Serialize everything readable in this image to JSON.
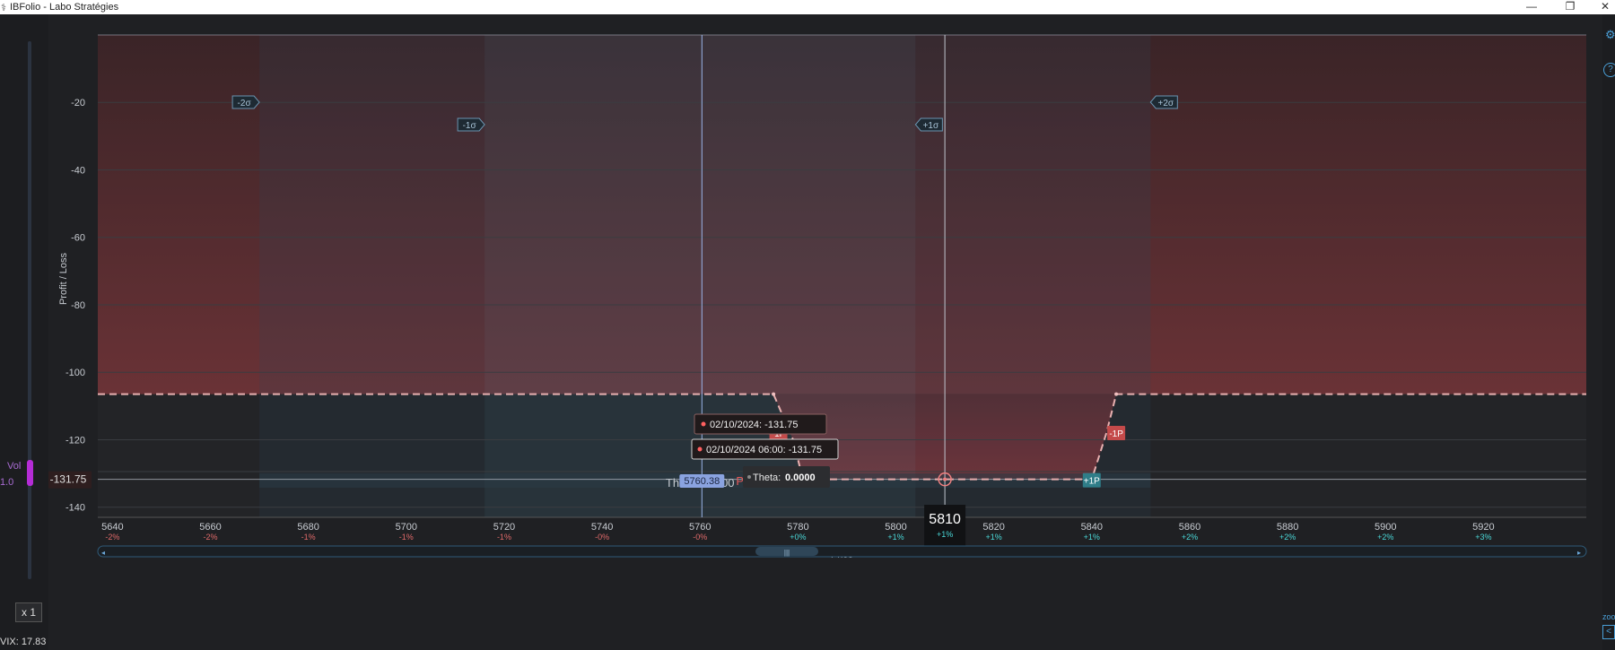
{
  "window": {
    "title": "IBFolio - Labo Stratégies",
    "minimize": "—",
    "restore": "❐",
    "close": "✕"
  },
  "left_panel": {
    "vol_label": "Vol",
    "vol_value": "1.0",
    "x1_button": "x 1",
    "vix": "VIX: 17.83"
  },
  "right_panel": {
    "help": "?",
    "zoom_label": "zoo",
    "zoom_btn": "<"
  },
  "chart_data": {
    "type": "line",
    "xlabel": "Price",
    "ylabel": "Profit / Loss",
    "xlim": [
      5637,
      5941
    ],
    "ylim": [
      -143,
      0
    ],
    "x_ticks": [
      {
        "value": 5640,
        "pct": "-2%"
      },
      {
        "value": 5660,
        "pct": "-2%"
      },
      {
        "value": 5680,
        "pct": "-1%"
      },
      {
        "value": 5700,
        "pct": "-1%"
      },
      {
        "value": 5720,
        "pct": "-1%"
      },
      {
        "value": 5740,
        "pct": "-0%"
      },
      {
        "value": 5760,
        "pct": "-0%"
      },
      {
        "value": 5780,
        "pct": "+0%"
      },
      {
        "value": 5800,
        "pct": "+1%"
      },
      {
        "value": 5810,
        "pct": "+1%"
      },
      {
        "value": 5820,
        "pct": "+1%"
      },
      {
        "value": 5840,
        "pct": "+1%"
      },
      {
        "value": 5860,
        "pct": "+2%"
      },
      {
        "value": 5880,
        "pct": "+2%"
      },
      {
        "value": 5900,
        "pct": "+2%"
      },
      {
        "value": 5920,
        "pct": "+3%"
      }
    ],
    "y_ticks": [
      -20,
      -40,
      -60,
      -80,
      -100,
      -120,
      -140
    ],
    "sigma_bands": [
      {
        "label": "-2σ",
        "x": 5670
      },
      {
        "label": "-1σ",
        "x": 5716
      },
      {
        "label": "+1σ",
        "x": 5804
      },
      {
        "label": "+2σ",
        "x": 5852
      }
    ],
    "series": [
      {
        "color": "#e85c5c",
        "dashed": true,
        "x": [
          5637,
          5775,
          5779,
          5781,
          5810,
          5840,
          5843,
          5845,
          5941
        ],
        "y": [
          -106.5,
          -106.5,
          -120,
          -131.75,
          -131.75,
          -131.75,
          -118,
          -106.5,
          -106.5
        ]
      }
    ],
    "markers": [
      {
        "label": "-1P",
        "x": 5776,
        "y": -118,
        "color": "#c44a4a"
      },
      {
        "label": "+1P",
        "x": 5779,
        "y": -132,
        "color": "#2f7d88"
      },
      {
        "label": "+1P",
        "x": 5840,
        "y": -132,
        "color": "#2f7d88"
      },
      {
        "label": "-1P",
        "x": 5845,
        "y": -118,
        "color": "#c44a4a"
      }
    ],
    "cursor": {
      "price_line": 5760.38,
      "price_label": "5760.38",
      "pnl_text": "PnL= -160,75",
      "current_price": 5810,
      "current_price_label": "5810",
      "current_price_pct": "+1%",
      "y_value": -131.75,
      "y_label": "-131.75"
    },
    "tooltips": [
      "02/10/2024: -131.75",
      "02/10/2024 06:00: -131.75"
    ],
    "theta": {
      "row_label": "Theta",
      "center_text": "Theta 0.0000",
      "tooltip_label": "Theta:",
      "tooltip_value": "0.0000"
    }
  }
}
